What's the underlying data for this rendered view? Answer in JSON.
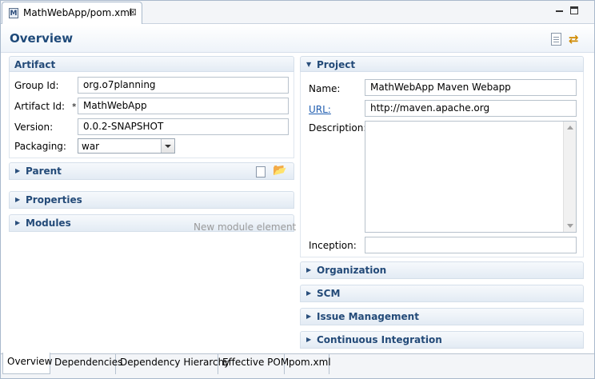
{
  "editor_tab": {
    "icon": "M",
    "title": "MathWebApp/pom.xml",
    "close": "⊠"
  },
  "header": {
    "title": "Overview"
  },
  "artifact": {
    "title": "Artifact",
    "group_id_label": "Group Id:",
    "group_id": "org.o7planning",
    "artifact_id_label": "Artifact Id:",
    "required_marker": "*",
    "artifact_id": "MathWebApp",
    "version_label": "Version:",
    "version": "0.0.2-SNAPSHOT",
    "packaging_label": "Packaging:",
    "packaging": "war"
  },
  "collapsed_left": {
    "parent": "Parent",
    "properties": "Properties",
    "modules": "Modules",
    "modules_hint": "New module element"
  },
  "project": {
    "title": "Project",
    "name_label": "Name:",
    "name": "MathWebApp Maven Webapp",
    "url_label": "URL:",
    "url": "http://maven.apache.org",
    "description_label": "Description:",
    "description": "",
    "inception_label": "Inception:",
    "inception": ""
  },
  "collapsed_right": {
    "organization": "Organization",
    "scm": "SCM",
    "issue_management": "Issue Management",
    "continuous_integration": "Continuous Integration"
  },
  "carets": {
    "expanded": "▼",
    "collapsed": "▶"
  },
  "icons": {
    "refresh": "⇄",
    "folder": "📂"
  },
  "bottom_tabs": [
    "Overview",
    "Dependencies",
    "Dependency Hierarchy",
    "Effective POM",
    "pom.xml"
  ]
}
